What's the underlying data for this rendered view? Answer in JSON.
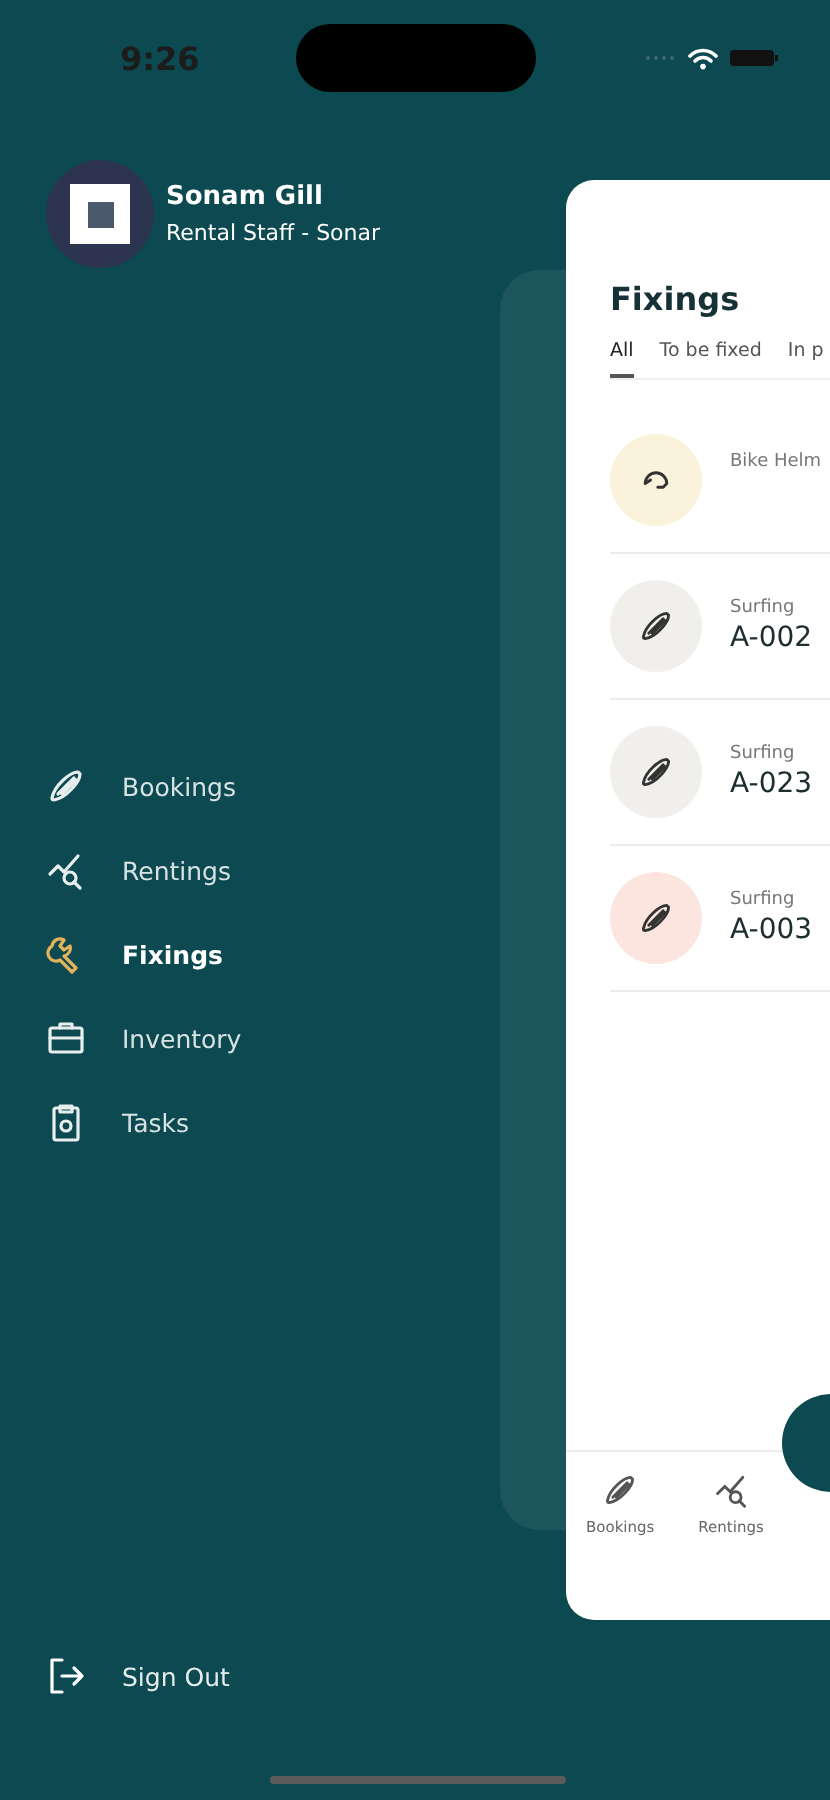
{
  "status_bar": {
    "time": "9:26"
  },
  "profile": {
    "name": "Sonam Gill",
    "role": "Rental Staff - Sonar"
  },
  "menu": [
    {
      "kind": "board",
      "label": "Bookings",
      "selected": false
    },
    {
      "kind": "chart",
      "label": "Rentings",
      "selected": false
    },
    {
      "kind": "wrench",
      "label": "Fixings",
      "selected": true
    },
    {
      "kind": "case",
      "label": "Inventory",
      "selected": false
    },
    {
      "kind": "clipboard",
      "label": "Tasks",
      "selected": false
    }
  ],
  "sign_out": {
    "label": "Sign Out"
  },
  "screen": {
    "title": "Fixings",
    "tabs": [
      {
        "label": "All",
        "selected": true
      },
      {
        "label": "To be fixed",
        "selected": false
      },
      {
        "label": "In p",
        "selected": false
      }
    ],
    "items": [
      {
        "kind": "helmet",
        "category": "Bike Helm",
        "color": "#fbf2dc"
      },
      {
        "kind": "board",
        "category": "Surfing",
        "code": "A-002",
        "color": "#f0efeb"
      },
      {
        "kind": "board",
        "category": "Surfing",
        "code": "A-023",
        "color": "#f0efeb"
      },
      {
        "kind": "board",
        "category": "Surfing",
        "code": "A-003",
        "color": "#fde5df"
      }
    ],
    "bottom_nav": [
      {
        "kind": "board",
        "label": "Bookings"
      },
      {
        "kind": "chart",
        "label": "Rentings"
      }
    ]
  }
}
